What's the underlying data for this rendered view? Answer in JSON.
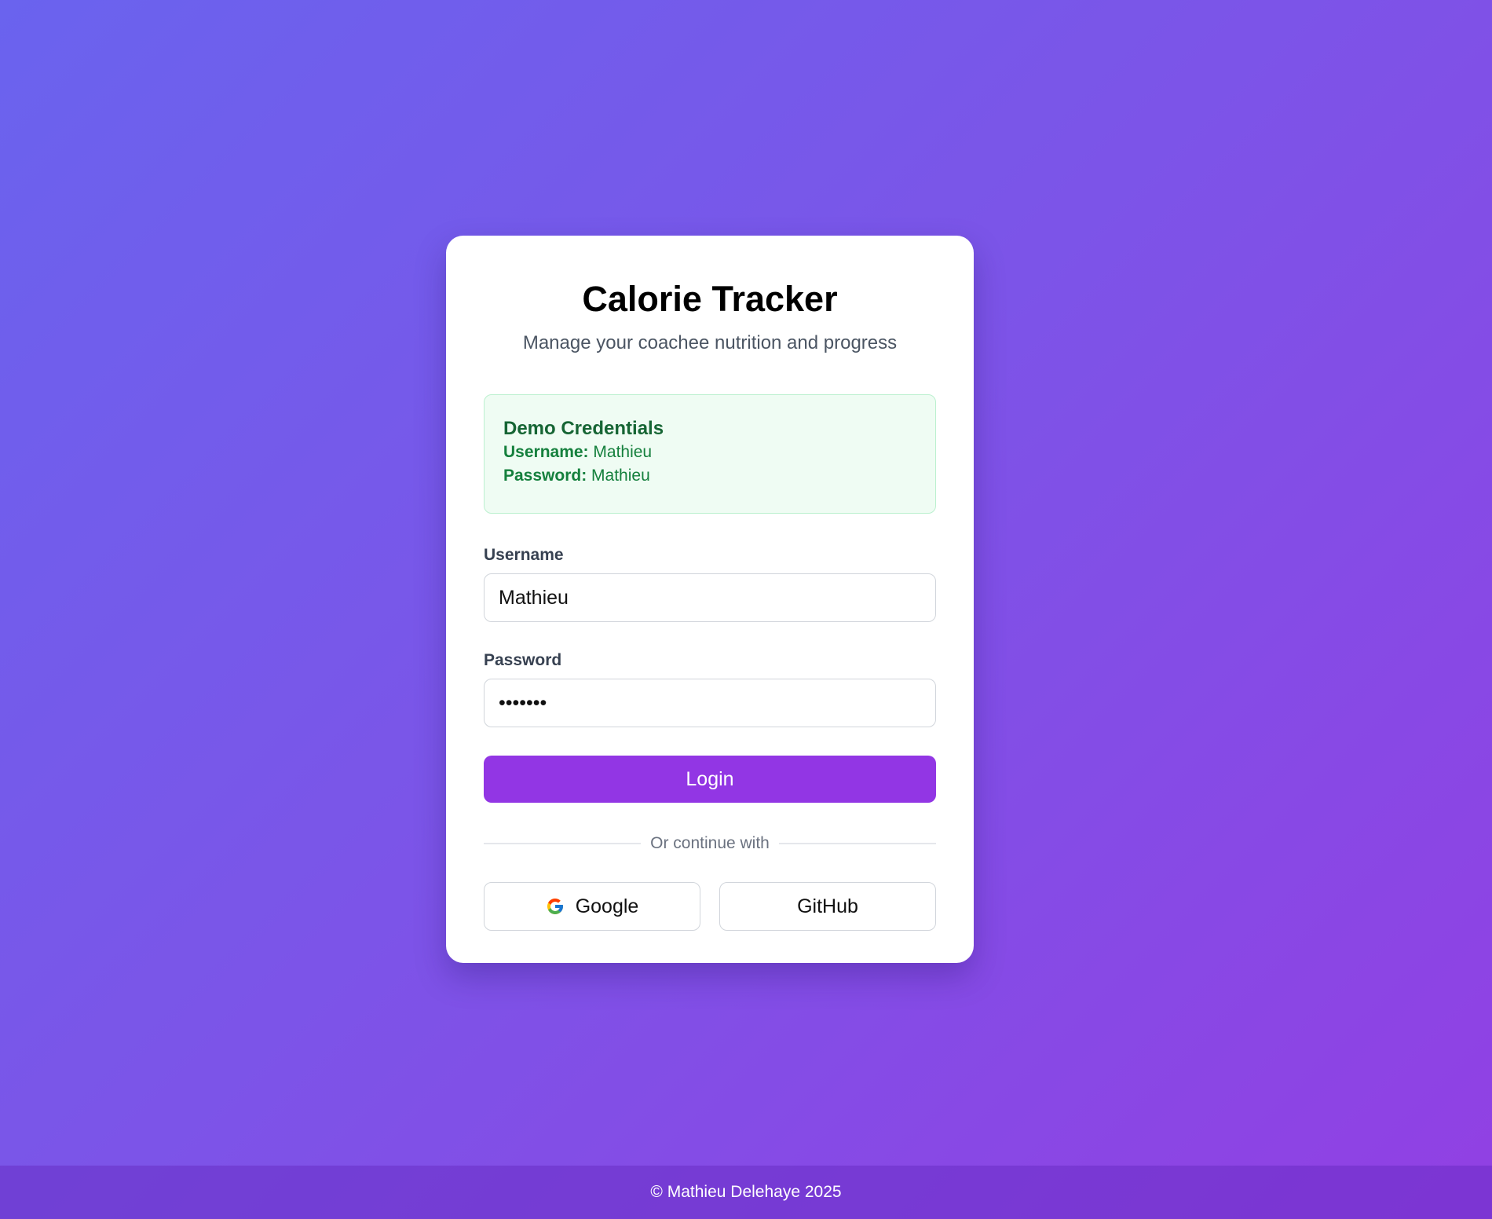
{
  "header": {
    "title": "Calorie Tracker",
    "subtitle": "Manage your coachee nutrition and progress"
  },
  "demo": {
    "title": "Demo Credentials",
    "username_label": "Username:",
    "username_value": "Mathieu",
    "password_label": "Password:",
    "password_value": "Mathieu"
  },
  "form": {
    "username_label": "Username",
    "username_value": "Mathieu",
    "password_label": "Password",
    "password_value": "Mathieu",
    "login_label": "Login"
  },
  "divider": {
    "text": "Or continue with"
  },
  "social": {
    "google_label": "Google",
    "github_label": "GitHub"
  },
  "footer": {
    "text": "© Mathieu Delehaye 2025"
  },
  "colors": {
    "accent": "#9236e4",
    "demo_bg": "#effcf3",
    "demo_text": "#166534",
    "gradient_start": "#6a63ee",
    "gradient_end": "#9140e3"
  },
  "icons": {
    "google": "google-icon"
  }
}
